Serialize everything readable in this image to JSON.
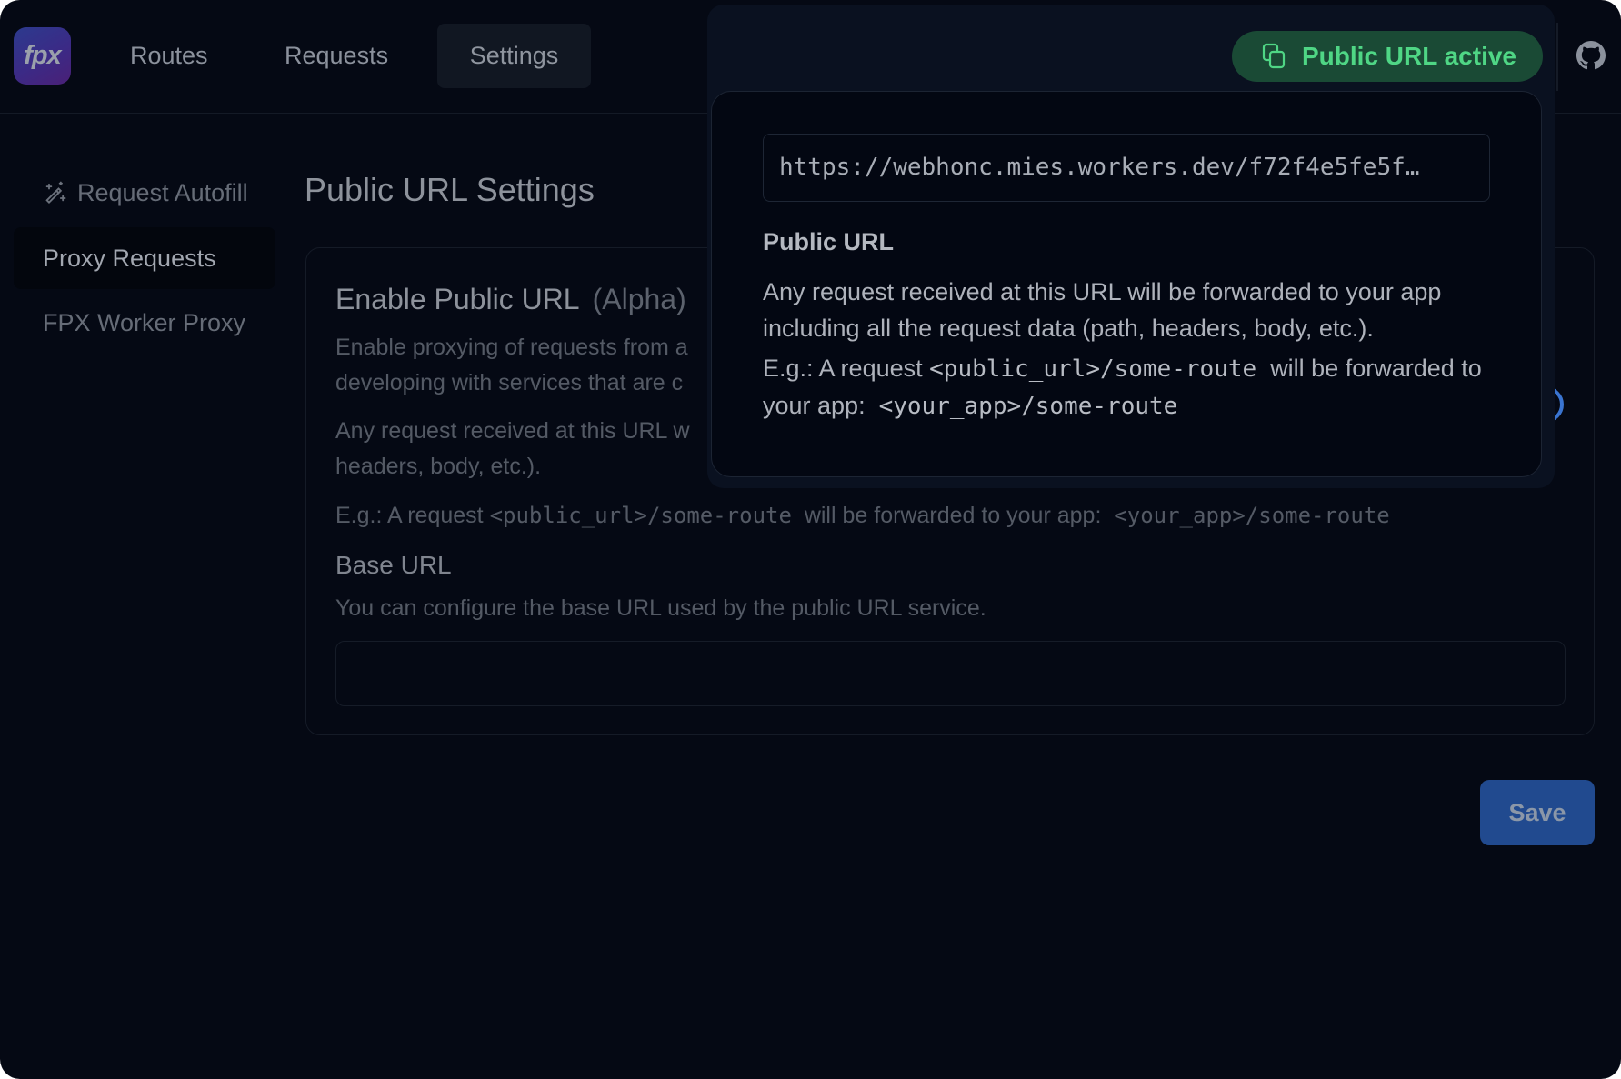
{
  "app": {
    "logo_text": "fpx"
  },
  "nav": {
    "items": [
      {
        "label": "Routes",
        "active": false
      },
      {
        "label": "Requests",
        "active": false
      },
      {
        "label": "Settings",
        "active": true
      }
    ]
  },
  "header": {
    "public_url_badge": "Public URL active",
    "badge_color": "#4fd685",
    "github_icon": "github-icon"
  },
  "sidebar": {
    "items": [
      {
        "label": "Request Autofill",
        "icon": "magic-wand-icon",
        "active": false
      },
      {
        "label": "Proxy Requests",
        "active": true
      },
      {
        "label": "FPX Worker Proxy",
        "active": false
      }
    ]
  },
  "main": {
    "title": "Public URL Settings",
    "card": {
      "heading": "Enable Public URL",
      "heading_tag": "(Alpha)",
      "toggle_on": true,
      "desc_line1": "Enable proxying of requests from a",
      "desc_line2": "developing with services that are c",
      "any_line1": "Any request received at this URL w",
      "any_line2": "headers, body, etc.).",
      "example_prefix": "E.g.: A request",
      "example_public": "<public_url>/some-route",
      "example_middle": "will be forwarded to your app:",
      "example_app": "<your_app>/some-route",
      "base_url_label": "Base URL",
      "base_url_desc": "You can configure the base URL used by the public URL service.",
      "base_url_value": ""
    },
    "save_label": "Save",
    "accent_color": "#214a8f"
  },
  "popover": {
    "url": "https://webhonc.mies.workers.dev/f72f4e5fe5f…",
    "heading": "Public URL",
    "body": "Any request received at this URL will be forwarded to your app including all the request data (path, headers, body, etc.).",
    "example_prefix": "E.g.: A request",
    "example_public": "<public_url>/some-route",
    "example_mid": "will be forwarded to your app:",
    "example_app": "<your_app>/some-route"
  }
}
